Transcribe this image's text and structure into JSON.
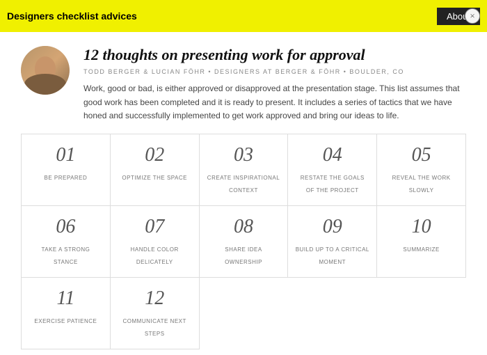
{
  "topbar": {
    "title": "Designers checklist advices",
    "about_label": "About",
    "close_label": "×"
  },
  "header": {
    "main_title": "12 thoughts on presenting work for approval",
    "subtitle": "TODD BERGER & LUCIAN FÖHR • DESIGNERS AT BERGER & FÖHR • BOULDER, CO",
    "description": "Work, good or bad, is either approved or disapproved at the presentation stage. This list assumes that good work has been completed and it is ready to present. It includes a series of tactics that we have honed and successfully implemented to get work approved and bring our ideas to life."
  },
  "grid": {
    "items": [
      {
        "number": "01",
        "label": "BE PREPARED"
      },
      {
        "number": "02",
        "label": "OPTIMIZE THE SPACE"
      },
      {
        "number": "03",
        "label": "CREATE INSPIRATIONAL CONTEXT"
      },
      {
        "number": "04",
        "label": "RESTATE THE GOALS OF THE PROJECT"
      },
      {
        "number": "05",
        "label": "REVEAL THE WORK SLOWLY"
      },
      {
        "number": "06",
        "label": "TAKE A STRONG STANCE"
      },
      {
        "number": "07",
        "label": "HANDLE COLOR DELICATELY"
      },
      {
        "number": "08",
        "label": "SHARE IDEA OWNERSHIP"
      },
      {
        "number": "09",
        "label": "BUILD UP TO A CRITICAL MOMENT"
      },
      {
        "number": "10",
        "label": "SUMMARIZE"
      },
      {
        "number": "11",
        "label": "EXERCISE PATIENCE"
      },
      {
        "number": "12",
        "label": "COMMUNICATE NEXT STEPS"
      }
    ]
  }
}
